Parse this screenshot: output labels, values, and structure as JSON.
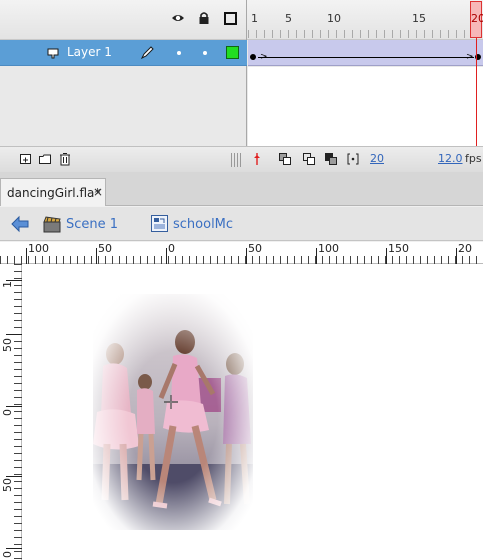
{
  "timeline": {
    "frame_numbers": [
      "1",
      "5",
      "10",
      "15",
      "20"
    ],
    "layer": {
      "name": "Layer 1",
      "color": "#22dd22"
    },
    "footer": {
      "current_frame": "20",
      "fps": "12.0",
      "fps_unit": "fps"
    }
  },
  "document": {
    "tab_label": "dancingGirl.fla*",
    "close_glyph": "×"
  },
  "editbar": {
    "scene_label": "Scene 1",
    "symbol_label": "schoolMc"
  },
  "ruler": {
    "horizontal_labels": [
      "100",
      "50",
      "0",
      "50",
      "100",
      "150",
      "20"
    ],
    "vertical_labels": [
      "1",
      "50",
      "0",
      "50",
      "0"
    ]
  },
  "colors": {
    "layer_selected": "#5b9ed6",
    "tween": "#c8c9ec",
    "playhead": "#e02020",
    "link": "#3a6fc2"
  },
  "icons": [
    "eye-icon",
    "lock-icon",
    "outline-icon",
    "layer-icon",
    "pencil-icon",
    "new-layer-icon",
    "new-folder-icon",
    "delete-icon",
    "back-arrow-icon",
    "scene-icon",
    "movieclip-icon"
  ]
}
